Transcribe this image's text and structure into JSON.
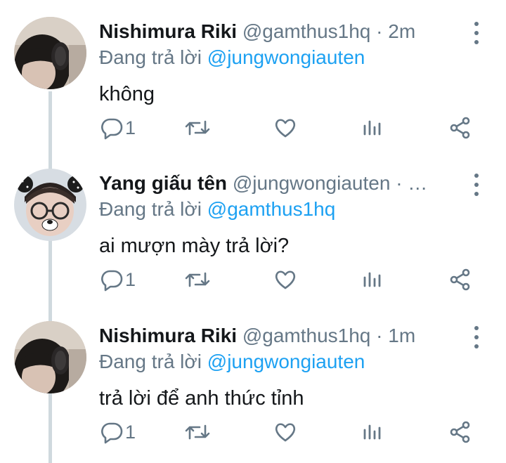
{
  "tweets": [
    {
      "name": "Nishimura Riki",
      "handle": "@gamthus1hq",
      "dot": "·",
      "time": "2m",
      "replying_prefix": "Đang trả lời ",
      "replying_to": "@jungwongiauten",
      "text": "không",
      "reply_count": "1",
      "avatar": "dark-haired-person-with-headphones"
    },
    {
      "name": "Yang giấu tên",
      "handle": "@jungwongiauten",
      "dot": "·",
      "time": "…",
      "replying_prefix": "Đang trả lời ",
      "replying_to": "@gamthus1hq",
      "text": "ai mượn mày trả lời?",
      "reply_count": "1",
      "avatar": "person-with-bear-ears-glasses-filter"
    },
    {
      "name": "Nishimura Riki",
      "handle": "@gamthus1hq",
      "dot": "·",
      "time": "1m",
      "replying_prefix": "Đang trả lời ",
      "replying_to": "@jungwongiauten",
      "text": "trả lời để anh thức tỉnh",
      "reply_count": "1",
      "avatar": "dark-haired-person-with-headphones"
    }
  ],
  "colors": {
    "text": "#14171a",
    "secondary": "#657786",
    "accent": "#1da1f2",
    "thread_line": "#cfd9de"
  },
  "icons": [
    "reply-icon",
    "retweet-icon",
    "like-icon",
    "analytics-icon",
    "share-icon",
    "more-icon"
  ]
}
